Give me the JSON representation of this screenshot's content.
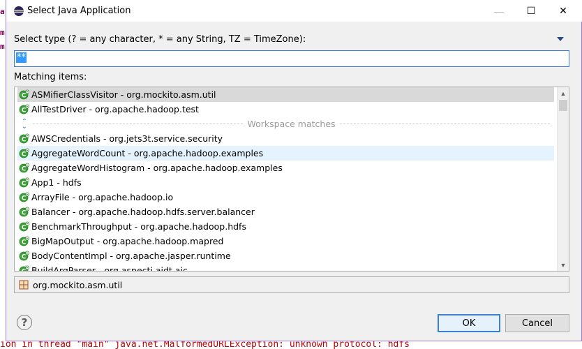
{
  "background": {
    "gutter_marks": [
      "a",
      "m",
      "m"
    ],
    "console_text": "ion in thread \"main\" java.net.MalformedURLException: unknown protocol: hdfs"
  },
  "dialog": {
    "title": "Select Java Application",
    "title_icon": "eclipse-icon",
    "window_buttons": {
      "minimize": "—",
      "maximize": "☐",
      "close": "✕"
    },
    "select_type_label": "Select type (? = any character, * = any String, TZ = TimeZone):",
    "pattern_value": "**",
    "matching_label": "Matching items:",
    "items_before": [
      {
        "name": "ASMifierClassVisitor",
        "package": "org.mockito.asm.util",
        "state": "selected"
      },
      {
        "name": "AllTestDriver",
        "package": "org.apache.hadoop.test",
        "state": ""
      }
    ],
    "separator_label": "Workspace matches",
    "items_after": [
      {
        "name": "AWSCredentials",
        "package": "org.jets3t.service.security",
        "state": ""
      },
      {
        "name": "AggregateWordCount",
        "package": "org.apache.hadoop.examples",
        "state": "hover"
      },
      {
        "name": "AggregateWordHistogram",
        "package": "org.apache.hadoop.examples",
        "state": ""
      },
      {
        "name": "App1",
        "package": "hdfs",
        "state": ""
      },
      {
        "name": "ArrayFile",
        "package": "org.apache.hadoop.io",
        "state": ""
      },
      {
        "name": "Balancer",
        "package": "org.apache.hadoop.hdfs.server.balancer",
        "state": ""
      },
      {
        "name": "BenchmarkThroughput",
        "package": "org.apache.hadoop.hdfs",
        "state": ""
      },
      {
        "name": "BigMapOutput",
        "package": "org.apache.hadoop.mapred",
        "state": ""
      },
      {
        "name": "BodyContentImpl",
        "package": "org.apache.jasper.runtime",
        "state": ""
      },
      {
        "name": "BuildArgParser",
        "package": "org.aspectj.ajdt.ajc",
        "state": ""
      }
    ],
    "selected_package": "org.mockito.asm.util",
    "help_label": "?",
    "ok_label": "OK",
    "cancel_label": "Cancel"
  },
  "colors": {
    "class_icon": "#3aa335",
    "selection": "#d9d9d9",
    "hover": "#e5f3ff",
    "focus_border": "#3c7fd9"
  }
}
